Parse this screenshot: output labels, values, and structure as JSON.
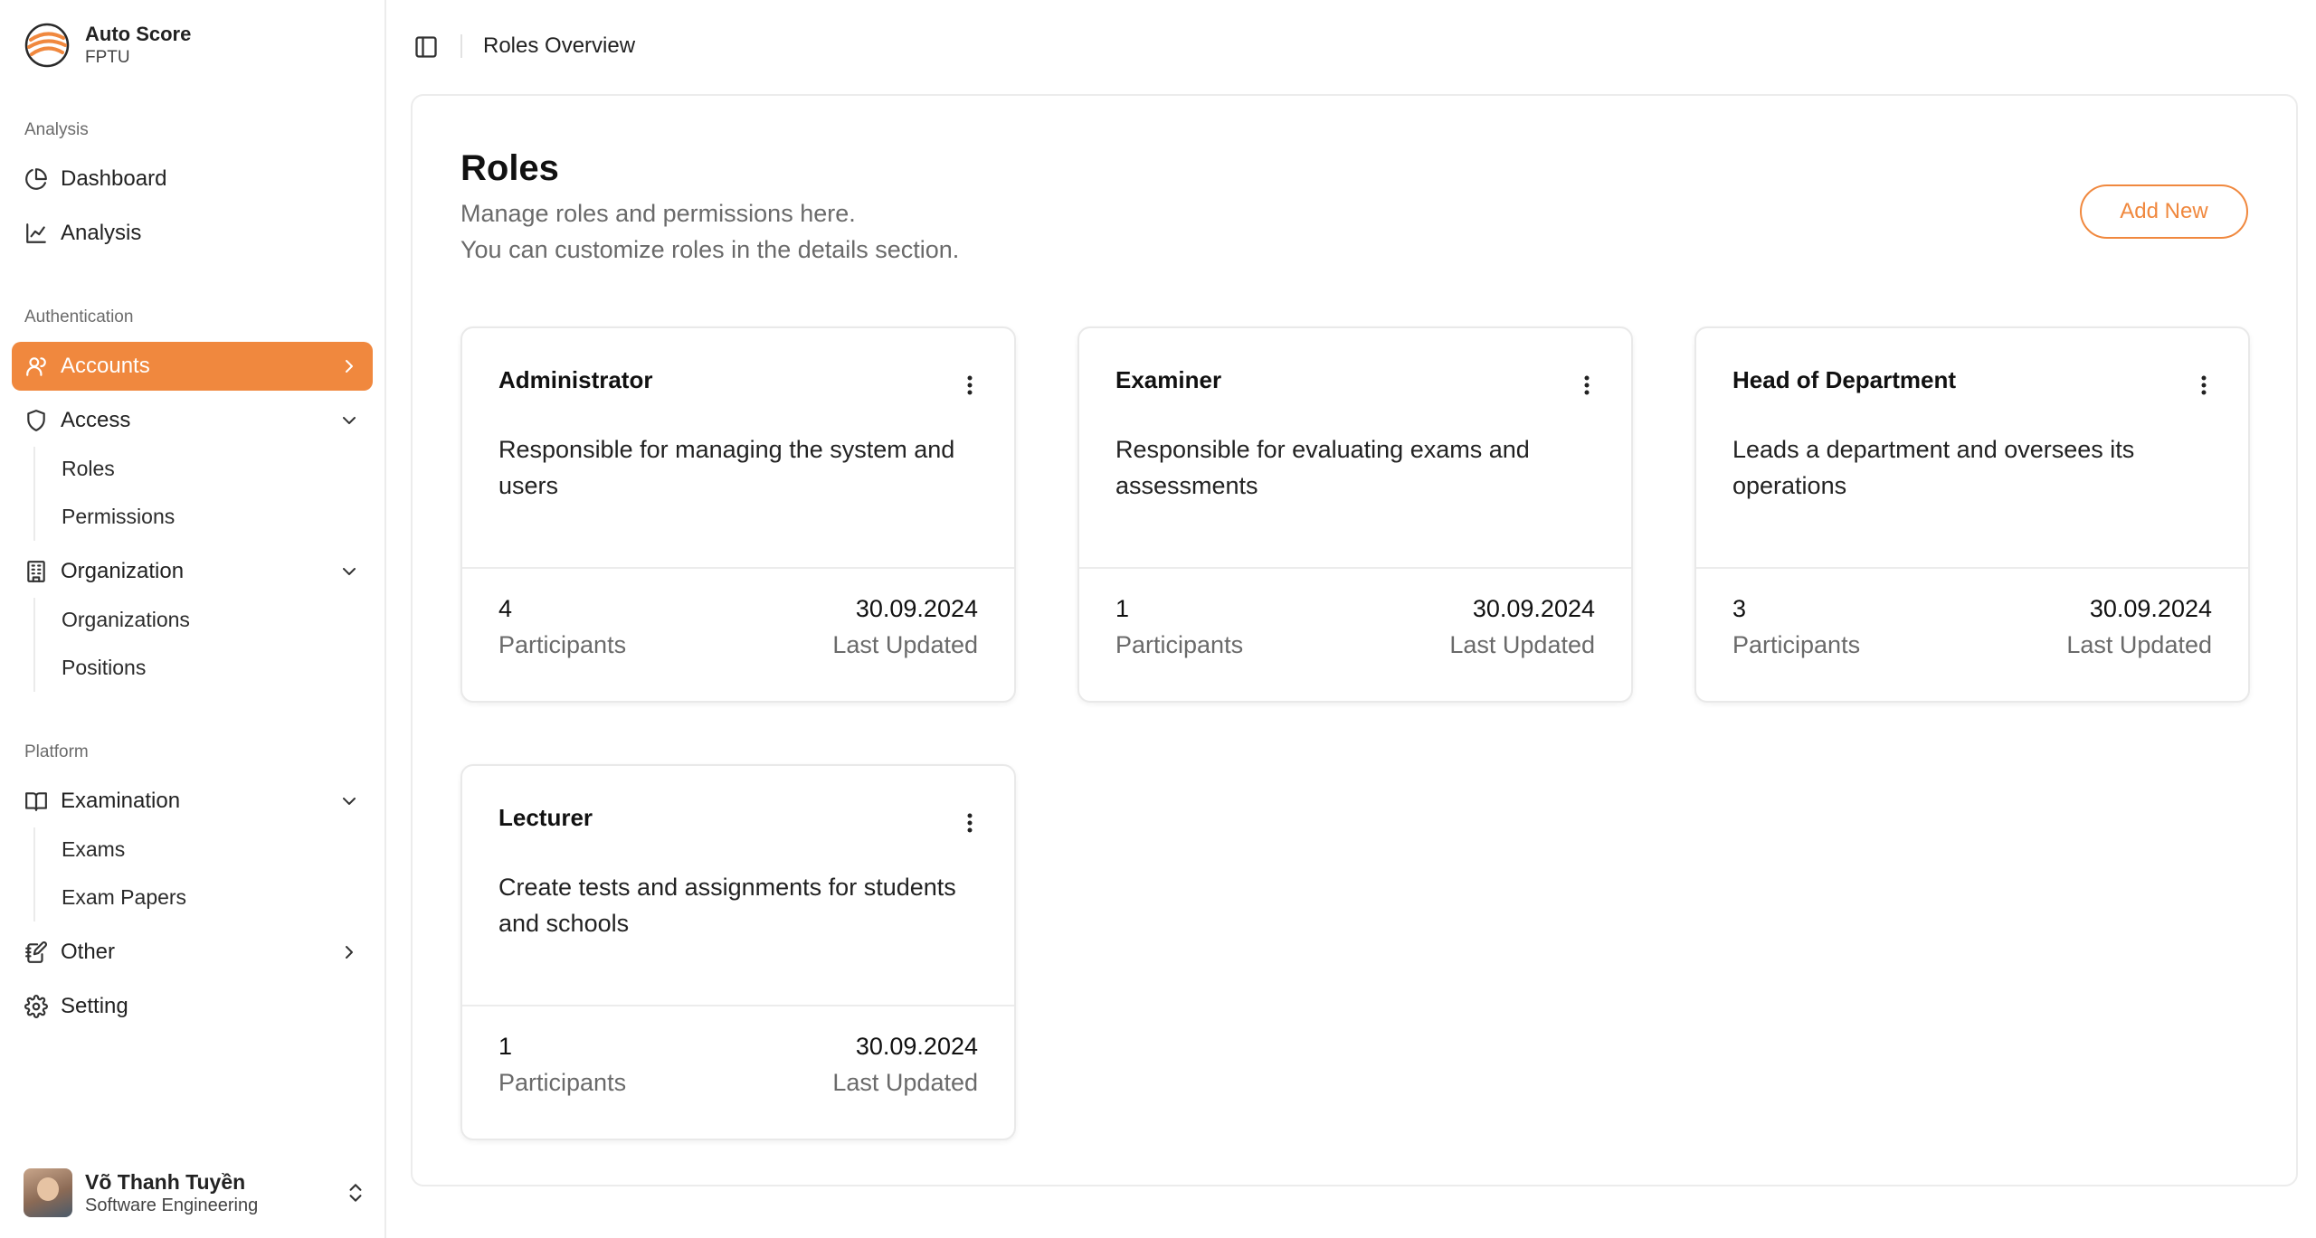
{
  "brand": {
    "name": "Auto Score",
    "subtitle": "FPTU"
  },
  "sidebar": {
    "groups": {
      "analysis": "Analysis",
      "authentication": "Authentication",
      "platform": "Platform"
    },
    "items": {
      "dashboard": "Dashboard",
      "analysis": "Analysis",
      "accounts": "Accounts",
      "access": "Access",
      "roles": "Roles",
      "permissions": "Permissions",
      "organization": "Organization",
      "organizations": "Organizations",
      "positions": "Positions",
      "examination": "Examination",
      "exams": "Exams",
      "exam_papers": "Exam Papers",
      "other": "Other",
      "setting": "Setting"
    },
    "active_item": "Accounts"
  },
  "user": {
    "name": "Võ Thanh Tuyền",
    "role": "Software Engineering"
  },
  "header": {
    "breadcrumb": "Roles Overview"
  },
  "page": {
    "title": "Roles",
    "description_line1": "Manage roles and permissions here.",
    "description_line2": "You can customize roles in the details section.",
    "add_button": "Add New"
  },
  "roles": [
    {
      "title": "Administrator",
      "description": "Responsible for managing the system and users",
      "participants": "4",
      "participants_label": "Participants",
      "updated": "30.09.2024",
      "updated_label": "Last Updated"
    },
    {
      "title": "Examiner",
      "description": "Responsible for evaluating exams and assessments",
      "participants": "1",
      "participants_label": "Participants",
      "updated": "30.09.2024",
      "updated_label": "Last Updated"
    },
    {
      "title": "Head of Department",
      "description": "Leads a department and oversees its operations",
      "participants": "3",
      "participants_label": "Participants",
      "updated": "30.09.2024",
      "updated_label": "Last Updated"
    },
    {
      "title": "Lecturer",
      "description": "Create tests and assignments for students and schools",
      "participants": "1",
      "participants_label": "Participants",
      "updated": "30.09.2024",
      "updated_label": "Last Updated"
    }
  ],
  "colors": {
    "accent": "#f0883e",
    "muted_text": "#6a6a6a",
    "border": "#ececec"
  }
}
